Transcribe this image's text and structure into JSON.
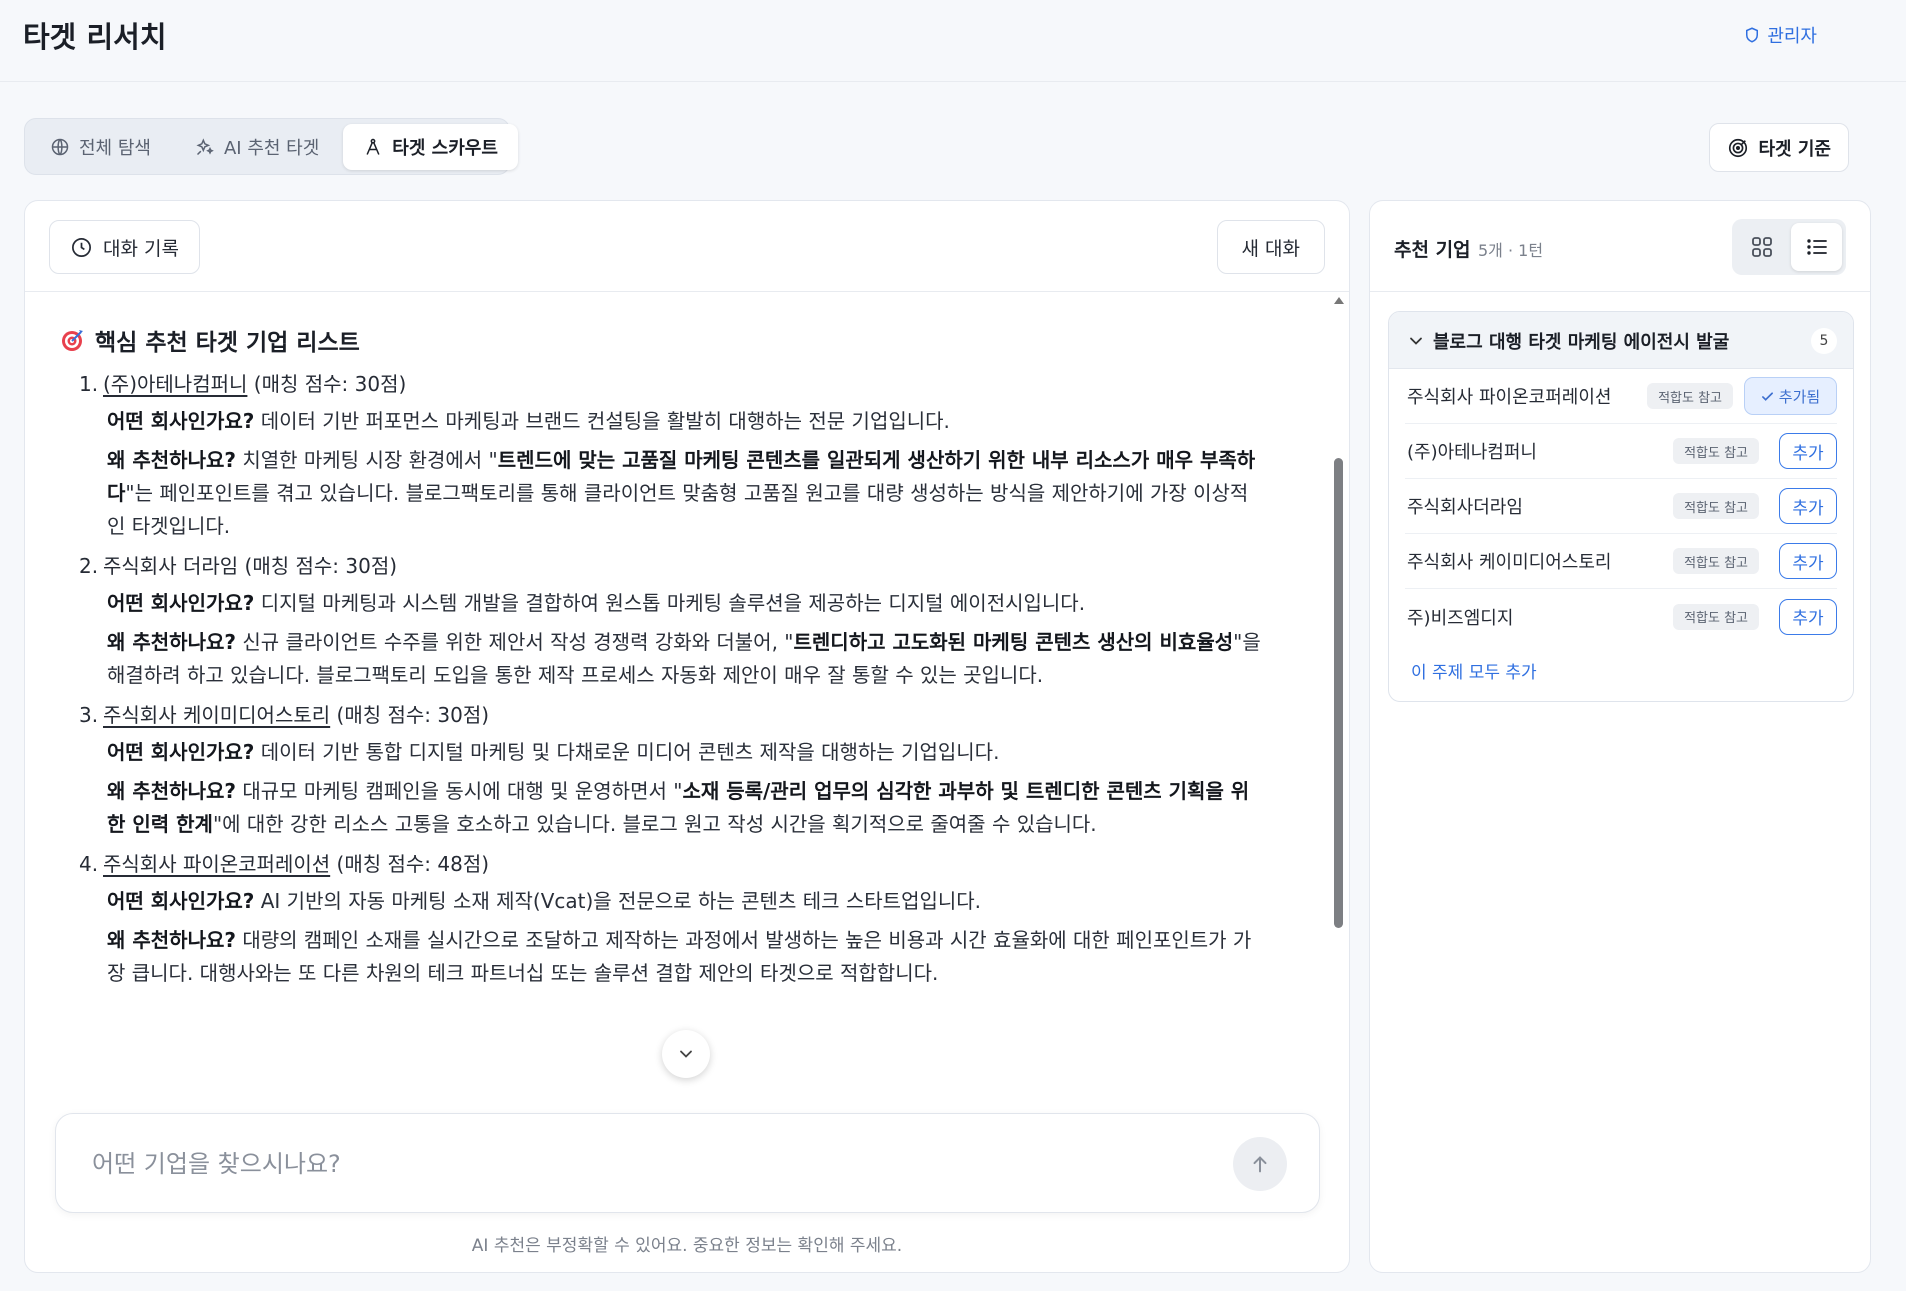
{
  "header": {
    "title": "타겟 리서치",
    "admin_label": "관리자"
  },
  "tabs": [
    {
      "label": "전체 탐색",
      "icon": "globe-icon",
      "active": false
    },
    {
      "label": "AI 추천 타겟",
      "icon": "sparkles-icon",
      "active": false
    },
    {
      "label": "타겟 스카우트",
      "icon": "compass-icon",
      "active": true
    }
  ],
  "criteria_button": {
    "label": "타겟 기준",
    "icon": "target-icon"
  },
  "chat": {
    "history_label": "대화 기록",
    "new_chat_label": "새 대화",
    "message": {
      "title": "핵심 추천 타겟 기업 리스트",
      "companies": [
        {
          "num": "1.",
          "name": "(주)아테나컴퍼니",
          "score": "(매칭 점수: 30점)",
          "what_label": "어떤 회사인가요?",
          "what_text": " 데이터 기반 퍼포먼스 마케팅과 브랜드 컨설팅을 활발히 대행하는 전문 기업입니다.",
          "why_label": "왜 추천하나요?",
          "why_pre": " 치열한 마케팅 시장 환경에서 \"",
          "why_bold": "트렌드에 맞는 고품질 마케팅 콘텐츠를 일관되게 생산하기 위한 내부 리소스가 매우 부족하다",
          "why_post": "\"는 페인포인트를 겪고 있습니다. 블로그팩토리를 통해 클라이언트 맞춤형 고품질 원고를 대량 생성하는 방식을 제안하기에 가장 이상적인 타겟입니다."
        },
        {
          "num": "2.",
          "name": "주식회사 더라임",
          "score": "(매칭 점수: 30점)",
          "what_label": "어떤 회사인가요?",
          "what_text": " 디지털 마케팅과 시스템 개발을 결합하여 원스톱 마케팅 솔루션을 제공하는 디지털 에이전시입니다.",
          "why_label": "왜 추천하나요?",
          "why_pre": " 신규 클라이언트 수주를 위한 제안서 작성 경쟁력 강화와 더불어, \"",
          "why_bold": "트렌디하고 고도화된 마케팅 콘텐츠 생산의 비효율성",
          "why_post": "\"을 해결하려 하고 있습니다. 블로그팩토리 도입을 통한 제작 프로세스 자동화 제안이 매우 잘 통할 수 있는 곳입니다."
        },
        {
          "num": "3.",
          "name": "주식회사 케이미디어스토리",
          "score": "(매칭 점수: 30점)",
          "what_label": "어떤 회사인가요?",
          "what_text": " 데이터 기반 통합 디지털 마케팅 및 다채로운 미디어 콘텐츠 제작을 대행하는 기업입니다.",
          "why_label": "왜 추천하나요?",
          "why_pre": " 대규모 마케팅 캠페인을 동시에 대행 및 운영하면서 \"",
          "why_bold": "소재 등록/관리 업무의 심각한 과부하 및 트렌디한 콘텐츠 기획을 위한 인력 한계",
          "why_post": "\"에 대한 강한 리소스 고통을 호소하고 있습니다. 블로그 원고 작성 시간을 획기적으로 줄여줄 수 있습니다."
        },
        {
          "num": "4.",
          "name": "주식회사 파이온코퍼레이션",
          "score": "(매칭 점수: 48점)",
          "what_label": "어떤 회사인가요?",
          "what_text": " AI 기반의 자동 마케팅 소재 제작(Vcat)을 전문으로 하는 콘텐츠 테크 스타트업입니다.",
          "why_label": "왜 추천하나요?",
          "why_pre": " 대량의 캠페인 소재를 실시간으로 조달하고 제작하는 과정에서 발생하는 높은 비용과 시간 효율화에 대한 페인포인트가 가장 큽니다. 대행사와는 또 다른 차원의 테크 파트너십 또는 솔루션 결합 제안의 타겟으로 적합합니다.",
          "why_bold": "",
          "why_post": ""
        }
      ]
    },
    "input_placeholder": "어떤 기업을 찾으시나요?",
    "disclaimer": "AI 추천은 부정확할 수 있어요. 중요한 정보는 확인해 주세요."
  },
  "side": {
    "title": "추천 기업",
    "meta": "5개 · 1턴",
    "group": {
      "title": "블로그 대행 타겟 마케팅 에이전시 발굴",
      "count": "5",
      "fit_label": "적합도 참고",
      "add_label": "추가",
      "added_label": "추가됨",
      "add_all_label": "이 주제 모두 추가",
      "rows": [
        {
          "name": "주식회사 파이온코퍼레이션",
          "added": true
        },
        {
          "name": "(주)아테나컴퍼니",
          "added": false
        },
        {
          "name": "주식회사더라임",
          "added": false
        },
        {
          "name": "주식회사 케이미디어스토리",
          "added": false
        },
        {
          "name": "주)비즈엠디지",
          "added": false
        }
      ]
    }
  },
  "colors": {
    "accent": "#2f6fe0",
    "background": "#f6f8fb"
  }
}
